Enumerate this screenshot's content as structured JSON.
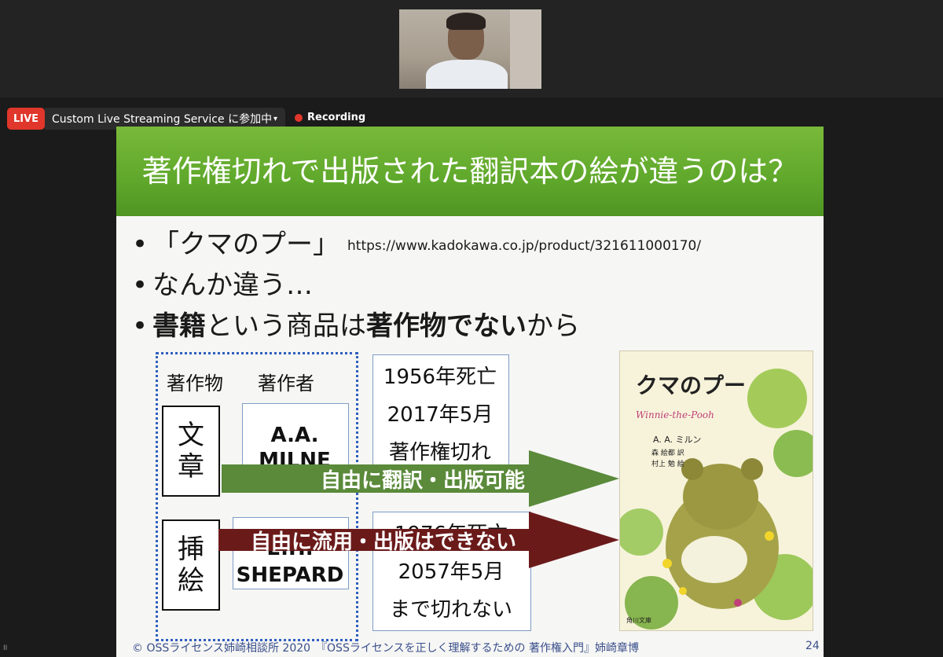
{
  "meeting": {
    "live_label": "LIVE",
    "stream_label": "Custom Live Streaming Service に参加中",
    "stream_caret": "▾",
    "recording_label": "Recording",
    "pause_indicator": "II"
  },
  "slide": {
    "title": "著作権切れで出版された翻訳本の絵が違うのは？",
    "bullet_char": "•",
    "bullets": [
      {
        "text": "「クマのプー」",
        "url": "https://www.kadokawa.co.jp/product/321611000170/"
      },
      {
        "text": "なんか違う…"
      },
      {
        "parts": [
          "書籍",
          "という商品は",
          "著作物でない",
          "から"
        ]
      }
    ],
    "header_work": "著作物",
    "header_author": "著作者",
    "row1": {
      "work_1": "文",
      "work_2": "章",
      "author_1": "A.A.",
      "author_2": "MILNE",
      "info": [
        "1956年死亡",
        "2017年5月",
        "著作権切れ"
      ]
    },
    "row2": {
      "work_1": "挿",
      "work_2": "絵",
      "author_1": "E.H.",
      "author_2": "SHEPARD",
      "info": [
        "1976年死亡",
        "2057年5月",
        "まで切れない"
      ]
    },
    "arrow_green": "自由に翻訳・出版可能",
    "arrow_red": "自由に流用・出版はできない",
    "book": {
      "title": "クマのプー",
      "subtitle": "Winnie-the-Pooh",
      "author": "A. A. ミルン",
      "translator": "森 絵都 訳",
      "illustrator": "村上 勉 絵",
      "publisher": "角川文庫"
    },
    "footer": "© OSSライセンス姉崎相談所 2020　『OSSライセンスを正しく理解するための 著作権入門』姉崎章博",
    "page_number": "24"
  },
  "colors": {
    "title_green": "#5fa82b",
    "arrow_green": "#5a8a3a",
    "arrow_red": "#6b1a1a",
    "live_red": "#e0362b",
    "dotted_blue": "#2f5fbf"
  }
}
